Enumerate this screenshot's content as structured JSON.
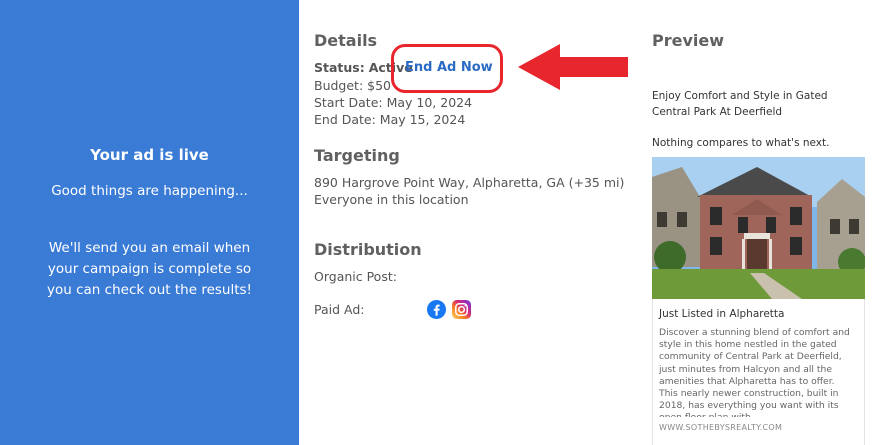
{
  "left": {
    "title": "Your ad is live",
    "subtitle": "Good things are happening...",
    "message": "We'll send you an email when your campaign is complete so you can check out the results!"
  },
  "details": {
    "heading": "Details",
    "status_label": "Status:",
    "status_value": "Active",
    "end_ad_label": "End Ad Now",
    "budget": "Budget: $50",
    "start_date": "Start Date: May 10, 2024",
    "end_date": "End Date: May 15, 2024"
  },
  "targeting": {
    "heading": "Targeting",
    "location": "890 Hargrove Point Way, Alpharetta, GA (+35 mi)",
    "audience": "Everyone in this location"
  },
  "distribution": {
    "heading": "Distribution",
    "organic_label": "Organic Post:",
    "paid_label": "Paid Ad:",
    "icons": [
      "facebook-icon",
      "instagram-icon"
    ]
  },
  "preview": {
    "heading": "Preview",
    "headline": "Enjoy Comfort and Style in Gated Central Park At Deerfield",
    "tagline": "Nothing compares to what's next.",
    "card_title": "Just Listed in Alpharetta",
    "card_body": "Discover a stunning blend of comfort and style in this home nestled in the gated community of Central Park at Deerfield, just minutes from Halcyon and all the amenities that Alpharetta has to offer. This nearly newer construction, built in 2018, has everything you want with its open floor plan with",
    "card_url": "WWW.SOTHEBYSREALTY.COM"
  },
  "colors": {
    "left_panel": "#3a7bd5",
    "highlight": "#e8262e",
    "link": "#2c6bc4"
  }
}
